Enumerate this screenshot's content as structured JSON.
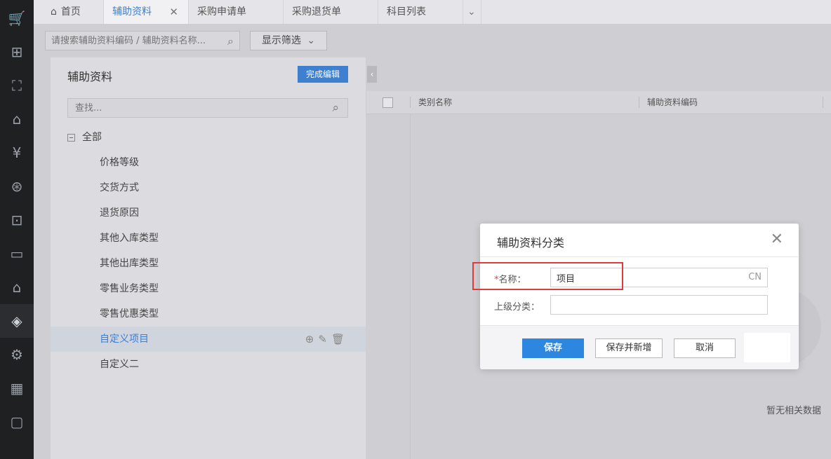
{
  "rail": {
    "icons": [
      "cart-icon",
      "chart-add-icon",
      "bag-icon",
      "warehouse-icon",
      "yen-shield-icon",
      "yen-circle-icon",
      "presentation-icon",
      "ticket-icon",
      "yen-house-icon",
      "layers-icon",
      "gear-icon",
      "apps-icon",
      "feedback-icon"
    ]
  },
  "tabs": {
    "home": "首页",
    "active": "辅助资料",
    "t3": "采购申请单",
    "t4": "采购退货单",
    "t5": "科目列表"
  },
  "toolbar": {
    "search_placeholder": "请搜索辅助资料编码 / 辅助资料名称...",
    "filter_label": "显示筛选"
  },
  "left": {
    "title": "辅助资料",
    "done_label": "完成编辑",
    "search_placeholder": "查找...",
    "root": "全部",
    "items": [
      "价格等级",
      "交货方式",
      "退货原因",
      "其他入库类型",
      "其他出库类型",
      "零售业务类型",
      "零售优惠类型",
      "自定义项目",
      "自定义二"
    ]
  },
  "table": {
    "col1": "类别名称",
    "col2": "辅助资料编码"
  },
  "empty_text": "暂无相关数据",
  "dialog": {
    "title": "辅助资料分类",
    "name_required": "*",
    "name_label": "名称：",
    "name_value": "项目",
    "lang": "CN",
    "parent_label": "上级分类：",
    "parent_value": "",
    "save": "保存",
    "save_new": "保存并新增",
    "cancel": "取消"
  }
}
